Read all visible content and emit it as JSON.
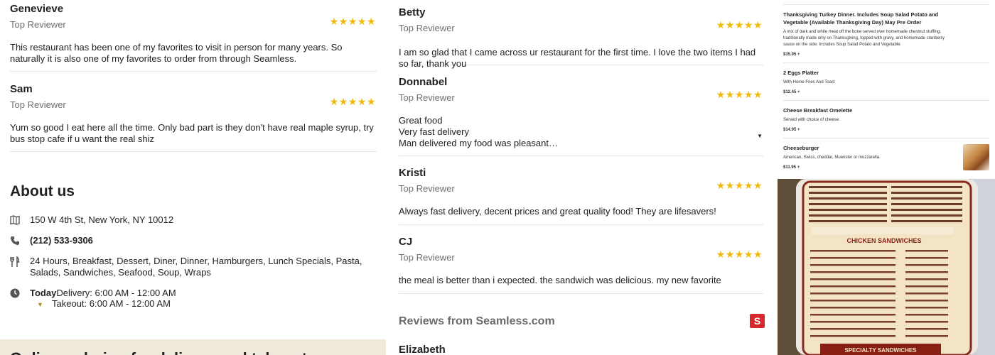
{
  "reviews_left": [
    {
      "name": "Genevieve",
      "badge": "Top Reviewer",
      "stars": "★★★★★",
      "text": "This restaurant has been one of my favorites to visit in person for many years. So naturally it is also one of my favorites to order from through Seamless."
    },
    {
      "name": "Sam",
      "badge": "Top Reviewer",
      "stars": "★★★★★",
      "text": "Yum so good I eat here all the time. Only bad part is they don't have real maple syrup, try bus stop cafe if u want the real shiz"
    }
  ],
  "about": {
    "title": "About us",
    "address": "150 W 4th St, New York, NY 10012",
    "phone": "(212) 533-9306",
    "categories": "24 Hours, Breakfast, Dessert, Diner, Dinner, Hamburgers, Lunch Specials, Pasta, Salads, Sandwiches, Seafood, Soup, Wraps",
    "hours_day": "Today",
    "delivery": "Delivery: 6:00 AM - 12:00 AM",
    "takeout": "Takeout: 6:00 AM - 12:00 AM"
  },
  "bottom_bar_text": "Online ordering for delivery and takeout",
  "reviews_mid": [
    {
      "name": "Betty",
      "badge": "Top Reviewer",
      "stars": "★★★★★",
      "text": "I am so glad that I came across ur restaurant for the first time. I love the two items I had so far, thank you"
    },
    {
      "name": "Donnabel",
      "badge": "Top Reviewer",
      "stars": "★★★★★",
      "lines": [
        "Great food",
        "Very fast delivery",
        "Man delivered my food was pleasant…"
      ]
    },
    {
      "name": "Kristi",
      "badge": "Top Reviewer",
      "stars": "★★★★★",
      "text": "Always fast delivery, decent prices and great quality food! They are lifesavers!"
    },
    {
      "name": "CJ",
      "badge": "Top Reviewer",
      "stars": "★★★★★",
      "text": "the meal is better than i expected. the sandwich was delicious. my new favorite"
    }
  ],
  "seamless": {
    "title": "Reviews from Seamless.com",
    "logo_letter": "S",
    "first_reviewer": "Elizabeth"
  },
  "menu_items": [
    {
      "name": "Thanksgiving Turkey Dinner. Includes Soup Salad Potato and Vegetable (Available Thanksgiving Day) May Pre Order",
      "desc": "A mix of dark and white meat off the bone served over homemade chestnut stuffing, traditionally made only on Thanksgiving, topped with gravy, and homemade cranberry sauce on the side. Includes Soup Salad Potato and Vegetable.",
      "price": "$35.95 +"
    },
    {
      "name": "2 Eggs Platter",
      "desc": "With Home Fries And Toast",
      "price": "$12.45 +"
    },
    {
      "name": "Cheese Breakfast Omelette",
      "desc": "Served with choice of cheese.",
      "price": "$14.95 +"
    },
    {
      "name": "Cheeseburger",
      "desc": "American, Swiss, cheddar, Muenster or mozzarella.",
      "price": "$11.95 +"
    }
  ],
  "menu_photo": {
    "heading_1": "CHICKEN SANDWICHES",
    "heading_2": "SPECIALTY SANDWICHES"
  },
  "colors": {
    "star": "#f0b90b",
    "seamless_red": "#d9272e",
    "beige": "#efeadb"
  }
}
